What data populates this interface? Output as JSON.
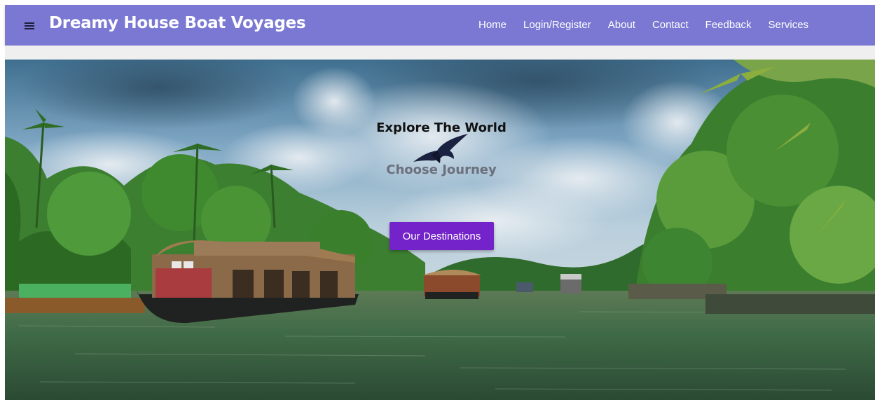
{
  "navbar": {
    "menu_icon": "hamburger-menu-icon",
    "brand": "Dreamy House Boat Voyages",
    "links": [
      {
        "label": "Home"
      },
      {
        "label": "Login/Register"
      },
      {
        "label": "About"
      },
      {
        "label": "Contact"
      },
      {
        "label": "Feedback"
      },
      {
        "label": "Services"
      }
    ],
    "background_color": "#7a78d2"
  },
  "hero": {
    "title": "Explore The World",
    "subtitle": "Choose Journey",
    "bird_icon": "flying-bird-icon",
    "cta_label": "Our Destinations",
    "cta_color": "#7323c9"
  }
}
